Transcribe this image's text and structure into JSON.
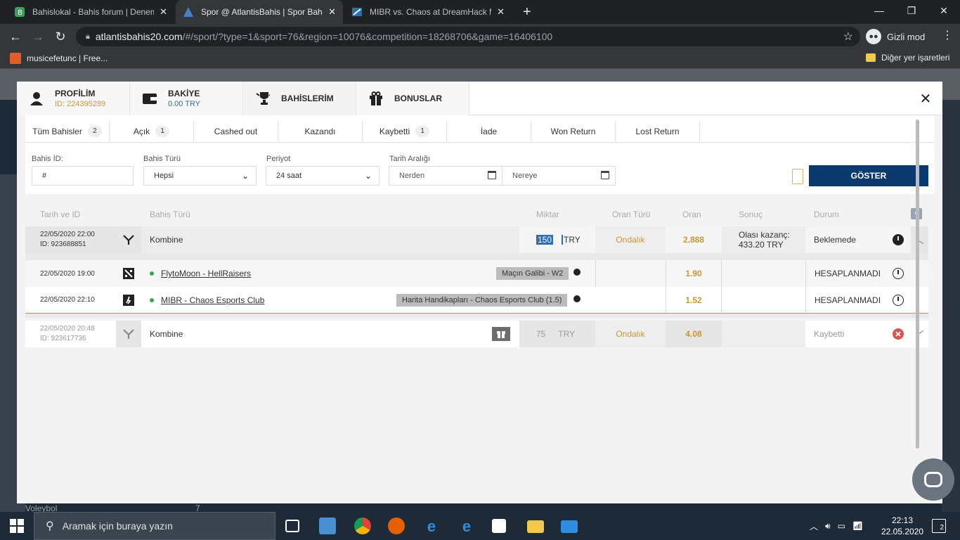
{
  "browser": {
    "tabs": [
      {
        "title": "Bahislokal - Bahis forum | Deneme",
        "icon": "bahislokal-icon"
      },
      {
        "title": "Spor @ AtlantisBahis | Spor Bahisi",
        "icon": "atlantis-icon"
      },
      {
        "title": "MIBR vs. Chaos at DreamHack Mas",
        "icon": "hltv-icon"
      }
    ],
    "close_glyph": "✕",
    "new_tab": "+",
    "url_host": "atlantisbahis20.com",
    "url_path": "/#/sport/?type=1&sport=76&region=10076&competition=18268706&game=16406100",
    "incognito_label": "Gizli mod",
    "bookmarks": [
      {
        "label": "musicefetunc | Free..."
      }
    ],
    "other_bookmarks": "Diğer yer işaretleri"
  },
  "modal": {
    "tabs": [
      {
        "label": "PROFİLİM",
        "sub": "ID: 224395289",
        "icon": "user-icon"
      },
      {
        "label": "BAKİYE",
        "sub": "0.00 TRY",
        "icon": "wallet-icon"
      },
      {
        "label": "BAHİSLERİM",
        "sub": "",
        "icon": "trophy-icon"
      },
      {
        "label": "BONUSLAR",
        "sub": "",
        "icon": "gift-icon"
      }
    ],
    "close": "✕"
  },
  "filters": {
    "tabs": [
      {
        "label": "Tüm Bahisler",
        "count": "2"
      },
      {
        "label": "Açık",
        "count": "1"
      },
      {
        "label": "Cashed out",
        "count": ""
      },
      {
        "label": "Kazandı",
        "count": ""
      },
      {
        "label": "Kaybetti",
        "count": "1"
      },
      {
        "label": "İade",
        "count": ""
      },
      {
        "label": "Won Return",
        "count": ""
      },
      {
        "label": "Lost Return",
        "count": ""
      }
    ],
    "bet_id_label": "Bahis İD:",
    "bet_id_value": "#",
    "bet_type_label": "Bahis Türü",
    "bet_type_value": "Hepsi",
    "period_label": "Periyot",
    "period_value": "24 saat",
    "date_range_label": "Tarih Aralığı",
    "from_placeholder": "Nerden",
    "to_placeholder": "Nereye",
    "show_button": "GÖSTER"
  },
  "table": {
    "headers": {
      "date_id": "Tarih ve ID",
      "bet_type": "Bahis Türü",
      "amount": "Miktar",
      "odds_type": "Oran Türü",
      "odds": "Oran",
      "result": "Sonuç",
      "status": "Durum"
    },
    "bets": [
      {
        "date": "22/05/2020 22:00",
        "id": "ID: 923688851",
        "type": "Kombine",
        "amount": "150",
        "currency": "TRY",
        "odds_type": "Ondalık",
        "odds": "2.888",
        "result_label": "Olası kazanç:",
        "result_value": "433.20 TRY",
        "status": "Beklemede",
        "selections": [
          {
            "date": "22/05/2020 19:00",
            "sport_icon": "dota2-icon",
            "match": "FlytoMoon - HellRaisers",
            "market": "Maçın Galibi - W2",
            "odds": "1.90",
            "status": "HESAPLANMADI"
          },
          {
            "date": "22/05/2020 22:10",
            "sport_icon": "csgo-icon",
            "match": "MIBR - Chaos Esports Club",
            "market": "Harita Handikapları - Chaos Esports Club (1.5)",
            "odds": "1.52",
            "status": "HESAPLANMADI"
          }
        ]
      },
      {
        "date": "22/05/2020 20:48",
        "id": "ID: 923617736",
        "type": "Kombine",
        "amount": "75",
        "currency": "TRY",
        "odds_type": "Ondalık",
        "odds": "4.08",
        "status": "Kaybetti"
      }
    ]
  },
  "background": {
    "sidebar_item": "Voleybol",
    "sidebar_count": "7"
  },
  "taskbar": {
    "search_placeholder": "Aramak için buraya yazın",
    "time": "22:13",
    "date": "22.05.2020",
    "notifications": "2"
  },
  "colors": {
    "accent_gold": "#c9963c",
    "primary_button": "#0b3a6e",
    "live_dot": "#3aa35a",
    "lost_red": "#d9534f"
  }
}
